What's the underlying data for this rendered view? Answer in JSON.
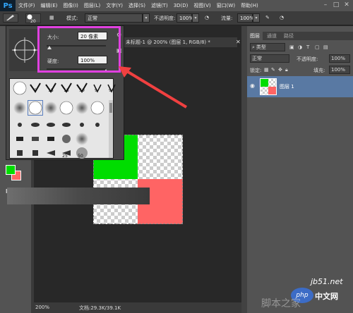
{
  "menubar": {
    "logo": "Ps",
    "items": [
      "文件(F)",
      "编辑(E)",
      "图像(I)",
      "图层(L)",
      "文字(Y)",
      "选择(S)",
      "滤镜(T)",
      "3D(D)",
      "视图(V)",
      "窗口(W)",
      "帮助(H)"
    ]
  },
  "options": {
    "brush_size": "20",
    "mode_label": "模式:",
    "mode_value": "正常",
    "opacity_label": "不透明度:",
    "opacity_value": "100%",
    "flow_label": "流量:",
    "flow_value": "100%"
  },
  "brush_popup": {
    "size_label": "大小:",
    "size_value": "20 像素",
    "hardness_label": "硬度:",
    "hardness_value": "100%",
    "size_fraction": 0.05,
    "hardness_fraction": 1.0,
    "numbers_row1": [
      "9",
      "15",
      "15",
      "50",
      "9",
      "9"
    ],
    "numbers_row6": [
      "25",
      "50"
    ]
  },
  "document": {
    "tab_title": "未标题-1 @ 200% (图层 1, RGB/8) *",
    "zoom": "200%",
    "file_info": "文档:29.3K/39.1K"
  },
  "layers_panel": {
    "tabs": [
      "图层",
      "通道",
      "路径"
    ],
    "kind_label": "类型",
    "blend_mode": "正常",
    "opacity_label": "不透明度:",
    "opacity_value": "100%",
    "lock_label": "锁定:",
    "fill_label": "填充:",
    "fill_value": "100%",
    "layer_name": "图层 1"
  },
  "colors": {
    "foreground": "#00dd00",
    "background": "#ff6464",
    "highlight_box": "#e040e0",
    "arrow": "#f04040",
    "layer_selected": "#5979a3"
  },
  "watermark": {
    "site": "jb51.net",
    "php": "php",
    "cn": "中文网",
    "script": "脚本之家"
  }
}
